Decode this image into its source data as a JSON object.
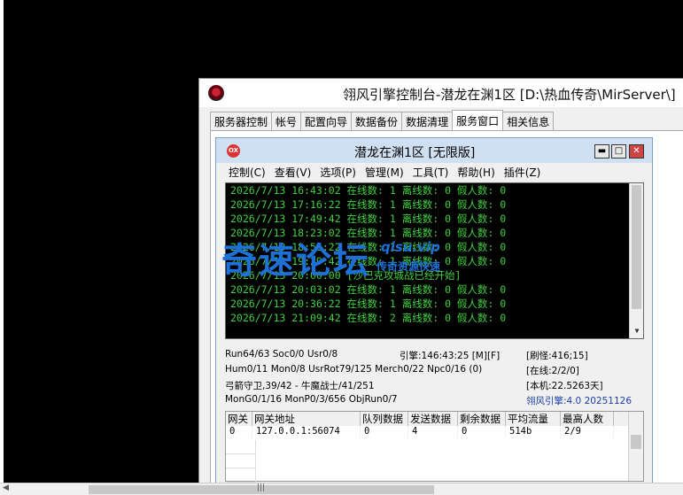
{
  "outer_window": {
    "title": "翎风引擎控制台-潜龙在渊1区 [D:\\热血传奇\\MirServer\\]",
    "tabs": [
      "服务器控制",
      "帐号",
      "配置向导",
      "数据备份",
      "数据清理",
      "服务窗口",
      "相关信息"
    ],
    "active_tab": "服务窗口"
  },
  "inner_window": {
    "title": "潜龙在渊1区 [无限版]",
    "logo_text": "OX",
    "controls": {
      "minimize": "▬",
      "maximize": "□",
      "close": "✕"
    },
    "menu": [
      "控制(C)",
      "查看(V)",
      "选项(P)",
      "管理(M)",
      "工具(T)",
      "帮助(H)",
      "插件(Z)"
    ]
  },
  "log": [
    "2026/7/13 16:43:02 在线数: 1 离线数: 0 假人数: 0",
    "2026/7/13 17:16:22 在线数: 1 离线数: 0 假人数: 0",
    "2026/7/13 17:49:42 在线数: 1 离线数: 0 假人数: 0",
    "2026/7/13 18:23:02 在线数: 1 离线数: 0 假人数: 0",
    "2026/7/13 18:56:22 在线数: 1 离线数: 0 假人数: 0",
    "2026/7/13 19:29:42 在线数: 1 离线数: 0 假人数: 0",
    "2026/7/13 20:00:00 [沙巴克攻城战已经开始]",
    "2026/7/13 20:03:02 在线数: 1 离线数: 0 假人数: 0",
    "2026/7/13 20:36:22 在线数: 1 离线数: 0 假人数: 0",
    "2026/7/13 21:09:42 在线数: 2 离线数: 0 假人数: 0"
  ],
  "status": {
    "line1_left": "Run64/63 Soc0/0 Usr0/8",
    "line1_mid": "引擎:146:43:25 [M][F]",
    "line1_right": "[刷怪:416;15]",
    "line2_left": "Hum0/11 Mon0/8 UsrRot79/125 Merch0/22 Npc0/16 (0)",
    "line2_right": "[在线:2/2/0]",
    "line3_left": "弓箭守卫,39/42 - 牛魔战士/41/251",
    "line3_right": "[本机:22.5263天]",
    "line4_left": "MonG0/1/16 MonP0/3/656 ObjRun0/7",
    "line4_right": "翎风引擎:4.0 20251126"
  },
  "gateway_table": {
    "headers": [
      "网关",
      "网关地址",
      "队列数据",
      "发送数据",
      "剩余数据",
      "平均流量",
      "最高人数"
    ],
    "rows": [
      [
        "0",
        "127.0.0.1:56074",
        "0",
        "4",
        "0",
        "514b",
        "2/9"
      ]
    ]
  },
  "watermark": {
    "big": "奇速论坛",
    "site": "qisu.vip",
    "sub": "传奇资源快速"
  },
  "colors": {
    "log_text": "#3fd23f",
    "log_bg": "#000000",
    "inner_title_bg": "#cfe0f3",
    "status_blue": "#1a3fa8",
    "watermark": "#1e6fd6"
  }
}
